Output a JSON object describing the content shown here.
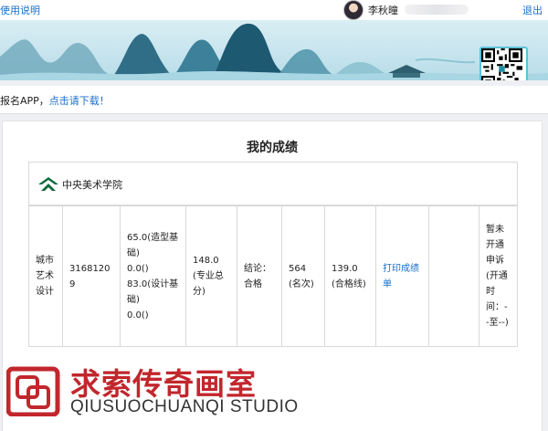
{
  "header": {
    "help_label": "使用说明",
    "username": "李秋曈",
    "logout_label": "退出"
  },
  "notice": {
    "text": "报名APP，",
    "link": "点击请下载！"
  },
  "page": {
    "title": "我的成绩"
  },
  "school": {
    "name": "中央美术学院"
  },
  "score_row": {
    "major": "城市艺术设计",
    "exam_no": "31681209",
    "subject_scores": [
      "65.0(造型基础)",
      "0.0()",
      "83.0(设计基础)",
      "0.0()"
    ],
    "total": "148.0(专业总分)",
    "conclusion": "结论：合格",
    "rank": "564(名次)",
    "pass_line": "139.0(合格线)",
    "print_label": "打印成绩单",
    "empty": "",
    "appeal": "暂未开通申诉(开通时间：--至--)"
  },
  "watermark": {
    "cn": "求索传奇画室",
    "en": "QIUSUOCHUANQI STUDIO"
  },
  "colors": {
    "link": "#1a6fc9",
    "watermark_red": "#c1272d",
    "logo_green": "#0e6b3a",
    "banner_teal": "#1f8fa6"
  }
}
